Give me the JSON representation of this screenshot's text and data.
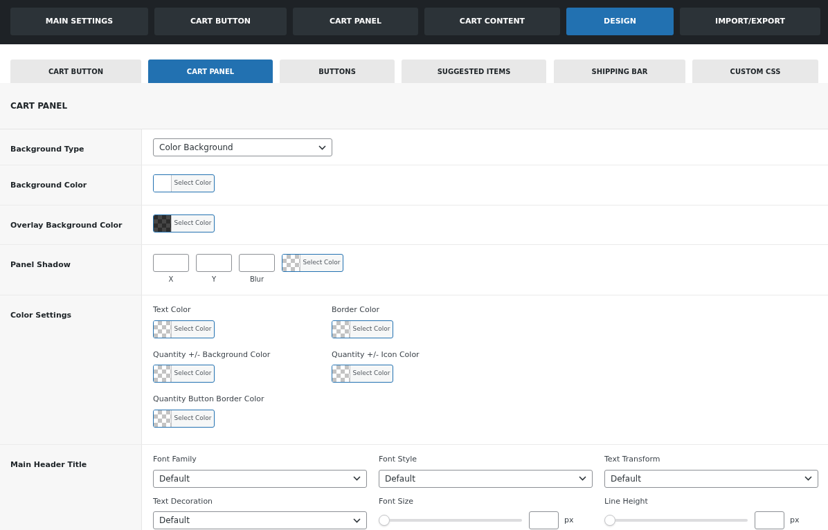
{
  "main_tabs": [
    {
      "label": "MAIN SETTINGS",
      "selected": false
    },
    {
      "label": "CART BUTTON",
      "selected": false
    },
    {
      "label": "CART PANEL",
      "selected": false
    },
    {
      "label": "CART CONTENT",
      "selected": false
    },
    {
      "label": "DESIGN",
      "selected": true
    },
    {
      "label": "IMPORT/EXPORT",
      "selected": false
    }
  ],
  "sub_tabs": [
    {
      "label": "CART BUTTON",
      "selected": false
    },
    {
      "label": "CART PANEL",
      "selected": true
    },
    {
      "label": "BUTTONS",
      "selected": false
    },
    {
      "label": "SUGGESTED ITEMS",
      "selected": false
    },
    {
      "label": "SHIPPING BAR",
      "selected": false
    },
    {
      "label": "CUSTOM CSS",
      "selected": false
    }
  ],
  "section_title": "CART PANEL",
  "rows": [
    {
      "kind": "select",
      "label": "Background Type",
      "value": "Color Background"
    },
    {
      "kind": "color",
      "label": "Background Color",
      "picker": {
        "color": "#ffffff",
        "transparent": false,
        "button": "Select Color"
      }
    },
    {
      "kind": "color",
      "label": "Overlay Background Color",
      "picker": {
        "color": "#2c2c2c",
        "transparent": true,
        "button": "Select Color"
      }
    },
    {
      "kind": "shadow",
      "label": "Panel Shadow",
      "inputs": [
        {
          "caption": "X"
        },
        {
          "caption": "Y"
        },
        {
          "caption": "Blur"
        }
      ],
      "picker": {
        "transparent": true,
        "button": "Select Color"
      }
    },
    {
      "kind": "color_grid",
      "label": "Color Settings",
      "fields": [
        {
          "label": "Text Color",
          "picker": {
            "transparent": true,
            "button": "Select Color"
          }
        },
        {
          "label": "Border Color",
          "picker": {
            "transparent": true,
            "button": "Select Color"
          }
        },
        {
          "label": "Quantity +/- Background Color",
          "picker": {
            "transparent": true,
            "button": "Select Color"
          }
        },
        {
          "label": "Quantity +/- Icon Color",
          "picker": {
            "transparent": true,
            "button": "Select Color"
          }
        },
        {
          "label": "Quantity Button Border Color",
          "picker": {
            "transparent": true,
            "button": "Select Color"
          }
        }
      ]
    },
    {
      "kind": "typography",
      "label": "Main Header Title",
      "fields": [
        {
          "kind": "select",
          "label": "Font Family",
          "value": "Default"
        },
        {
          "kind": "select",
          "label": "Font Style",
          "value": "Default"
        },
        {
          "kind": "select",
          "label": "Text Transform",
          "value": "Default"
        },
        {
          "kind": "select",
          "label": "Text Decoration",
          "value": "Default"
        },
        {
          "kind": "slider",
          "label": "Font Size",
          "level": 0,
          "unit": "px"
        },
        {
          "kind": "slider",
          "label": "Line Height",
          "level": 0,
          "unit": "px"
        }
      ]
    }
  ]
}
